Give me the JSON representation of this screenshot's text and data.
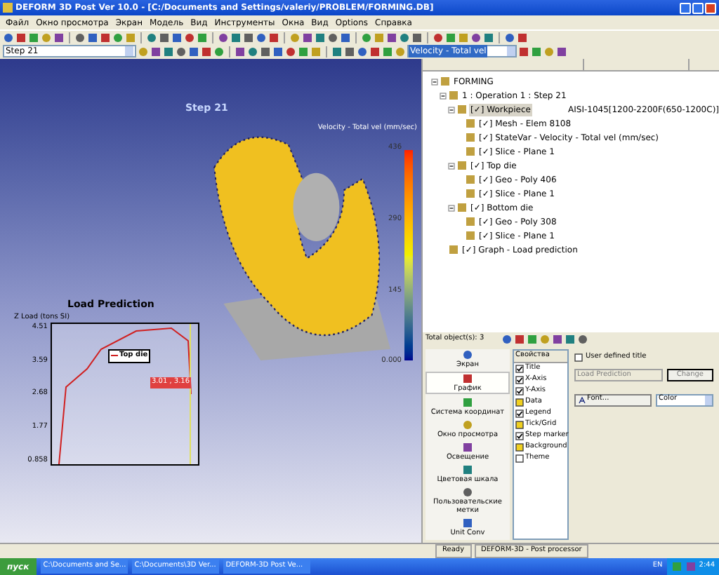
{
  "window": {
    "title": "DEFORM 3D Post Ver 10.0 - [C:/Documents and Settings/valeriy/PROBLEM/FORMING.DB]"
  },
  "menu": [
    "Файл",
    "Окно просмотра",
    "Экран",
    "Модель",
    "Вид",
    "Инструменты",
    "Окна",
    "Вид",
    "Options",
    "Справка"
  ],
  "step_select": {
    "value": "Step  21"
  },
  "variable_select": {
    "value": "Velocity - Total vel"
  },
  "viewport": {
    "step_label": "Step   21",
    "legend_title": "Velocity - Total vel (mm/sec)",
    "legend_ticks": [
      "436",
      "290",
      "145",
      "0.000"
    ],
    "load_chart": {
      "title": "Load Prediction",
      "ylabel": "Z Load (tons SI)",
      "yticks": [
        "4.51",
        "3.59",
        "2.68",
        "1.77",
        "0.858"
      ],
      "legend": "Top die",
      "tooltip": "3.01 , 3.16"
    }
  },
  "tree": {
    "children": [
      {
        "label": "FORMING",
        "selected": false,
        "children": [
          {
            "label": "1 : Operation 1 : Step 21",
            "selected": false,
            "children": [
              {
                "label": "[✓] Workpiece",
                "selected": true,
                "material": "AISI-1045[1200-2200F(650-1200C)]",
                "children": [
                  {
                    "label": "[✓] Mesh - Elem 8108",
                    "selected": false
                  },
                  {
                    "label": "[✓] StateVar - Velocity - Total vel (mm/sec)",
                    "selected": false
                  },
                  {
                    "label": "[✓] Slice - Plane 1",
                    "selected": false
                  }
                ]
              },
              {
                "label": "[✓] Top die",
                "selected": false,
                "children": [
                  {
                    "label": "[✓] Geo - Poly 406",
                    "selected": false
                  },
                  {
                    "label": "[✓] Slice - Plane 1",
                    "selected": false
                  }
                ]
              },
              {
                "label": "[✓] Bottom die",
                "selected": false,
                "children": [
                  {
                    "label": "[✓] Geo - Poly 308",
                    "selected": false
                  },
                  {
                    "label": "[✓] Slice - Plane 1",
                    "selected": false
                  }
                ]
              }
            ]
          },
          {
            "label": "[✓] Graph - Load prediction",
            "selected": false
          }
        ]
      }
    ]
  },
  "total_objects": "Total object(s): 3",
  "categories": [
    {
      "label": "Экран",
      "selected": false
    },
    {
      "label": "График",
      "selected": true
    },
    {
      "label": "Система координат",
      "selected": false
    },
    {
      "label": "Окно просмотра",
      "selected": false
    },
    {
      "label": "Освещение",
      "selected": false
    },
    {
      "label": "Цветовая шкала",
      "selected": false
    },
    {
      "label": "Пользовательские метки",
      "selected": false
    },
    {
      "label": "Unit Conv",
      "selected": false
    }
  ],
  "properties": {
    "header": "Свойства",
    "items": [
      {
        "label": "Title",
        "checked": true,
        "filled": false
      },
      {
        "label": "X-Axis",
        "checked": true,
        "filled": false
      },
      {
        "label": "Y-Axis",
        "checked": true,
        "filled": false
      },
      {
        "label": "Data",
        "checked": false,
        "filled": true
      },
      {
        "label": "Legend",
        "checked": true,
        "filled": false
      },
      {
        "label": "Tick/Grid",
        "checked": false,
        "filled": true
      },
      {
        "label": "Step marker",
        "checked": true,
        "filled": false
      },
      {
        "label": "Background",
        "checked": false,
        "filled": true
      },
      {
        "label": "Theme",
        "checked": false,
        "filled": false
      }
    ]
  },
  "title_settings": {
    "user_defined": {
      "label": "User defined title",
      "checked": false
    },
    "title_field": {
      "value": "Load Prediction",
      "disabled": true
    },
    "change_button": "Change",
    "font_button": "Font...",
    "color_select": "Color"
  },
  "status_bar": [
    "Ready",
    "DEFORM-3D - Post processor"
  ],
  "taskbar": {
    "start": "пуск",
    "tasks": [
      "C:\\Documents and Se...",
      "C:\\Documents\\3D Ver...",
      "DEFORM-3D Post Ve..."
    ],
    "lang": "EN",
    "clock": "2:44"
  }
}
